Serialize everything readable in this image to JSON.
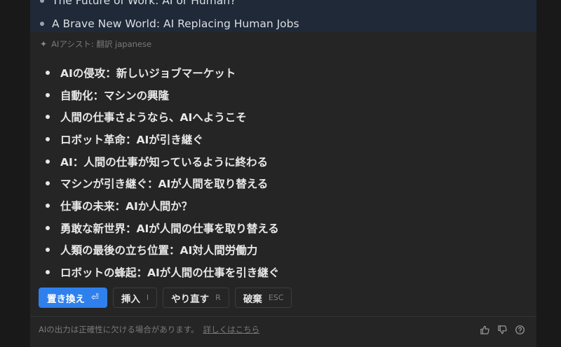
{
  "document": {
    "lines": [
      "The Future of Work: AI or Human?",
      "A Brave New World: AI Replacing Human Jobs"
    ]
  },
  "assistant": {
    "header": "AIアシスト: 翻訳 japanese",
    "results": [
      "AIの侵攻：新しいジョブマーケット",
      "自動化：マシンの興隆",
      "人間の仕事さようなら、AIへようこそ",
      "ロボット革命：AIが引き継ぐ",
      "AI：人間の仕事が知っているように終わる",
      "マシンが引き継ぐ：AIが人間を取り替える",
      "仕事の未来：AIか人間か？",
      "勇敢な新世界：AIが人間の仕事を取り替える",
      "人類の最後の立ち位置：AI対人間労働力",
      "ロボットの蜂起：AIが人間の仕事を引き継ぐ"
    ]
  },
  "actions": {
    "replace": {
      "label": "置き換え",
      "key": "⏎"
    },
    "insert": {
      "label": "挿入",
      "key": "I"
    },
    "retry": {
      "label": "やり直す",
      "key": "R"
    },
    "discard": {
      "label": "破棄",
      "key": "ESC"
    }
  },
  "footer": {
    "disclaimer": "AIの出力は正確性に欠ける場合があります。",
    "link": "詳しくはこちら"
  },
  "colors": {
    "accent": "#2f80ed",
    "panel": "#252525",
    "selection": "#1f2937"
  }
}
